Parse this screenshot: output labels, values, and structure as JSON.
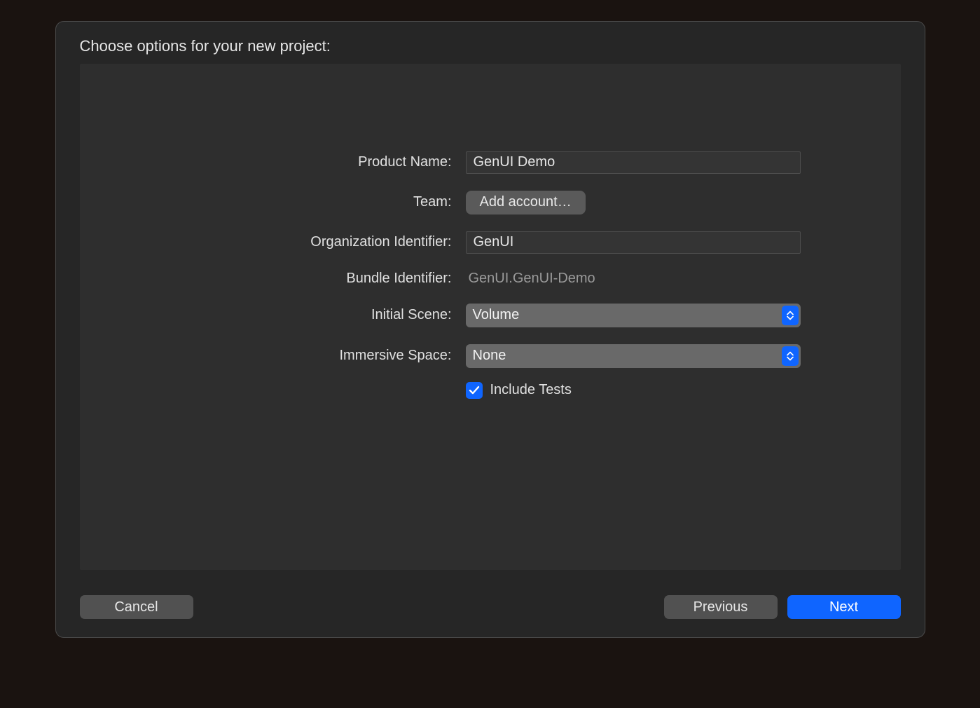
{
  "sheet": {
    "title": "Choose options for your new project:"
  },
  "form": {
    "product_name": {
      "label": "Product Name:",
      "value": "GenUI Demo"
    },
    "team": {
      "label": "Team:",
      "button_label": "Add account…"
    },
    "org_identifier": {
      "label": "Organization Identifier:",
      "value": "GenUI"
    },
    "bundle_identifier": {
      "label": "Bundle Identifier:",
      "value": "GenUI.GenUI-Demo"
    },
    "initial_scene": {
      "label": "Initial Scene:",
      "value": "Volume"
    },
    "immersive_space": {
      "label": "Immersive Space:",
      "value": "None"
    },
    "include_tests": {
      "label": "Include Tests",
      "checked": true
    }
  },
  "buttons": {
    "cancel": "Cancel",
    "previous": "Previous",
    "next": "Next"
  },
  "colors": {
    "accent": "#0f65ff"
  }
}
